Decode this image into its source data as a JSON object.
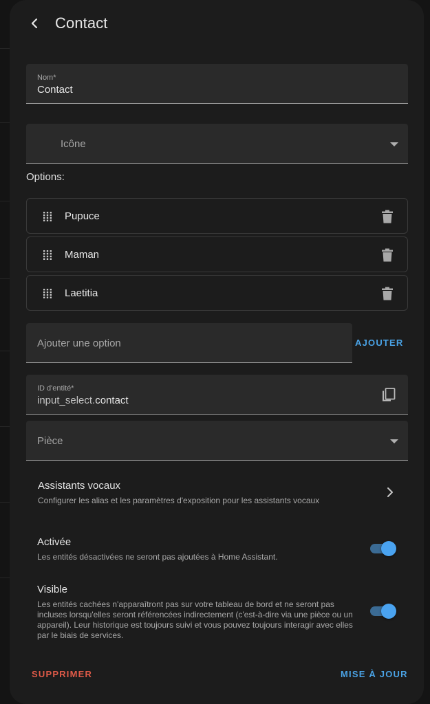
{
  "header": {
    "title": "Contact",
    "back_icon": "chevron-left-icon"
  },
  "name_field": {
    "label": "Nom*",
    "value": "Contact"
  },
  "icon_field": {
    "placeholder": "Icône",
    "icon": "dropdown-arrow-icon"
  },
  "options": {
    "label": "Options:",
    "items": [
      {
        "label": "Pupuce"
      },
      {
        "label": "Maman"
      },
      {
        "label": "Laetitia"
      }
    ],
    "handle_icon": "drag-handle-icon",
    "delete_icon": "trash-icon"
  },
  "add_option": {
    "placeholder": "Ajouter une option",
    "button_label": "AJOUTER"
  },
  "entity_id": {
    "label": "ID d'entité*",
    "prefix": "input_select.",
    "value": "contact",
    "copy_icon": "copy-icon"
  },
  "area_field": {
    "placeholder": "Pièce"
  },
  "voice_assistants": {
    "title": "Assistants vocaux",
    "subtitle": "Configurer les alias et les paramètres d'exposition pour les assistants vocaux"
  },
  "enabled_setting": {
    "title": "Activée",
    "description": "Les entités désactivées ne seront pas ajoutées à Home Assistant.",
    "on": true
  },
  "visible_setting": {
    "title": "Visible",
    "description": "Les entités cachées n'apparaîtront pas sur votre tableau de bord et ne seront pas incluses lorsqu'elles seront référencées indirectement (c'est-à-dire via une pièce ou un appareil). Leur historique est toujours suivi et vous pouvez toujours interagir avec elles par le biais de services.",
    "on": true
  },
  "footer": {
    "delete_label": "SUPPRIMER",
    "update_label": "MISE À JOUR"
  },
  "colors": {
    "accent": "#4aa3e6",
    "danger": "#e05a48",
    "surface": "#1c1c1c",
    "field": "#2a2a2a"
  }
}
